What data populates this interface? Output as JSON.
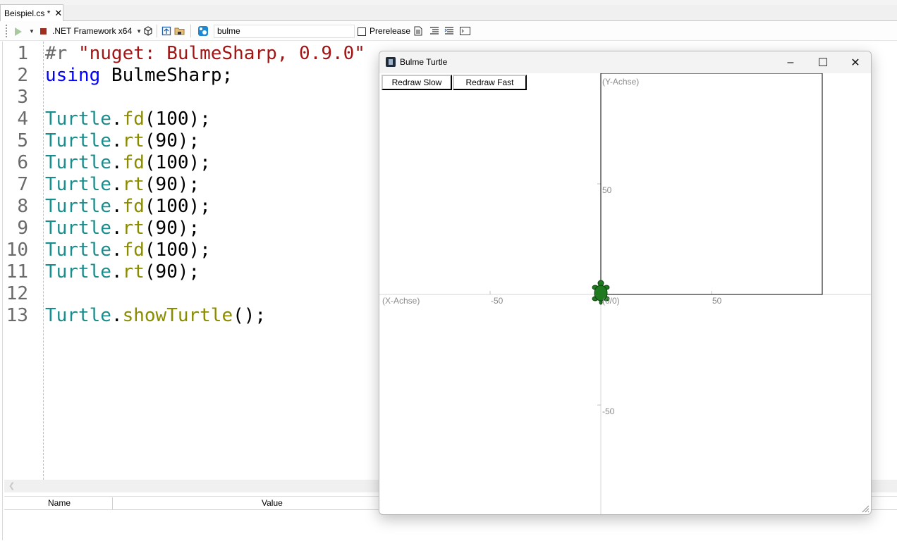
{
  "tabs": {
    "active_label": "Beispiel.cs *",
    "close_glyph": "✕"
  },
  "toolbar": {
    "framework": ".NET Framework x64",
    "package_search_value": "bulme",
    "prerelease_label": "Prerelease",
    "prerelease_checked": false
  },
  "code_lines": [
    {
      "num": "1",
      "tokens": [
        {
          "t": "#r ",
          "c": "dir"
        },
        {
          "t": "\"nuget: BulmeSharp, 0.9.0\"",
          "c": "str"
        }
      ]
    },
    {
      "num": "2",
      "tokens": [
        {
          "t": "using",
          "c": "kw"
        },
        {
          "t": " BulmeSharp;",
          "c": "plain"
        }
      ]
    },
    {
      "num": "3",
      "tokens": []
    },
    {
      "num": "4",
      "tokens": [
        {
          "t": "Turtle",
          "c": "type"
        },
        {
          "t": ".",
          "c": "plain"
        },
        {
          "t": "fd",
          "c": "meth"
        },
        {
          "t": "(100);",
          "c": "plain"
        }
      ]
    },
    {
      "num": "5",
      "tokens": [
        {
          "t": "Turtle",
          "c": "type"
        },
        {
          "t": ".",
          "c": "plain"
        },
        {
          "t": "rt",
          "c": "meth"
        },
        {
          "t": "(90);",
          "c": "plain"
        }
      ]
    },
    {
      "num": "6",
      "tokens": [
        {
          "t": "Turtle",
          "c": "type"
        },
        {
          "t": ".",
          "c": "plain"
        },
        {
          "t": "fd",
          "c": "meth"
        },
        {
          "t": "(100);",
          "c": "plain"
        }
      ]
    },
    {
      "num": "7",
      "tokens": [
        {
          "t": "Turtle",
          "c": "type"
        },
        {
          "t": ".",
          "c": "plain"
        },
        {
          "t": "rt",
          "c": "meth"
        },
        {
          "t": "(90);",
          "c": "plain"
        }
      ]
    },
    {
      "num": "8",
      "tokens": [
        {
          "t": "Turtle",
          "c": "type"
        },
        {
          "t": ".",
          "c": "plain"
        },
        {
          "t": "fd",
          "c": "meth"
        },
        {
          "t": "(100);",
          "c": "plain"
        }
      ]
    },
    {
      "num": "9",
      "tokens": [
        {
          "t": "Turtle",
          "c": "type"
        },
        {
          "t": ".",
          "c": "plain"
        },
        {
          "t": "rt",
          "c": "meth"
        },
        {
          "t": "(90);",
          "c": "plain"
        }
      ]
    },
    {
      "num": "10",
      "tokens": [
        {
          "t": "Turtle",
          "c": "type"
        },
        {
          "t": ".",
          "c": "plain"
        },
        {
          "t": "fd",
          "c": "meth"
        },
        {
          "t": "(100);",
          "c": "plain"
        }
      ]
    },
    {
      "num": "11",
      "tokens": [
        {
          "t": "Turtle",
          "c": "type"
        },
        {
          "t": ".",
          "c": "plain"
        },
        {
          "t": "rt",
          "c": "meth"
        },
        {
          "t": "(90);",
          "c": "plain"
        }
      ]
    },
    {
      "num": "12",
      "tokens": []
    },
    {
      "num": "13",
      "tokens": [
        {
          "t": "Turtle",
          "c": "type"
        },
        {
          "t": ".",
          "c": "plain"
        },
        {
          "t": "showTurtle",
          "c": "meth"
        },
        {
          "t": "();",
          "c": "plain"
        }
      ]
    }
  ],
  "watch_panel": {
    "col_name": "Name",
    "col_value": "Value"
  },
  "turtle_window": {
    "title": "Bulme Turtle",
    "redraw_slow": "Redraw Slow",
    "redraw_fast": "Redraw Fast",
    "y_axis_label": "(Y-Achse)",
    "x_axis_label": "(X-Achse)",
    "origin_label": "(0/0)",
    "tick_x_neg": "-50",
    "tick_x_pos": "50",
    "tick_y_pos": "50",
    "tick_y_neg": "-50",
    "turtle_color": "#1f7a1f"
  },
  "colors": {
    "string": "#a31515",
    "keyword": "#0000ff",
    "type": "#1b8c8c",
    "method": "#8b8b00",
    "stop": "#a12d1e"
  }
}
